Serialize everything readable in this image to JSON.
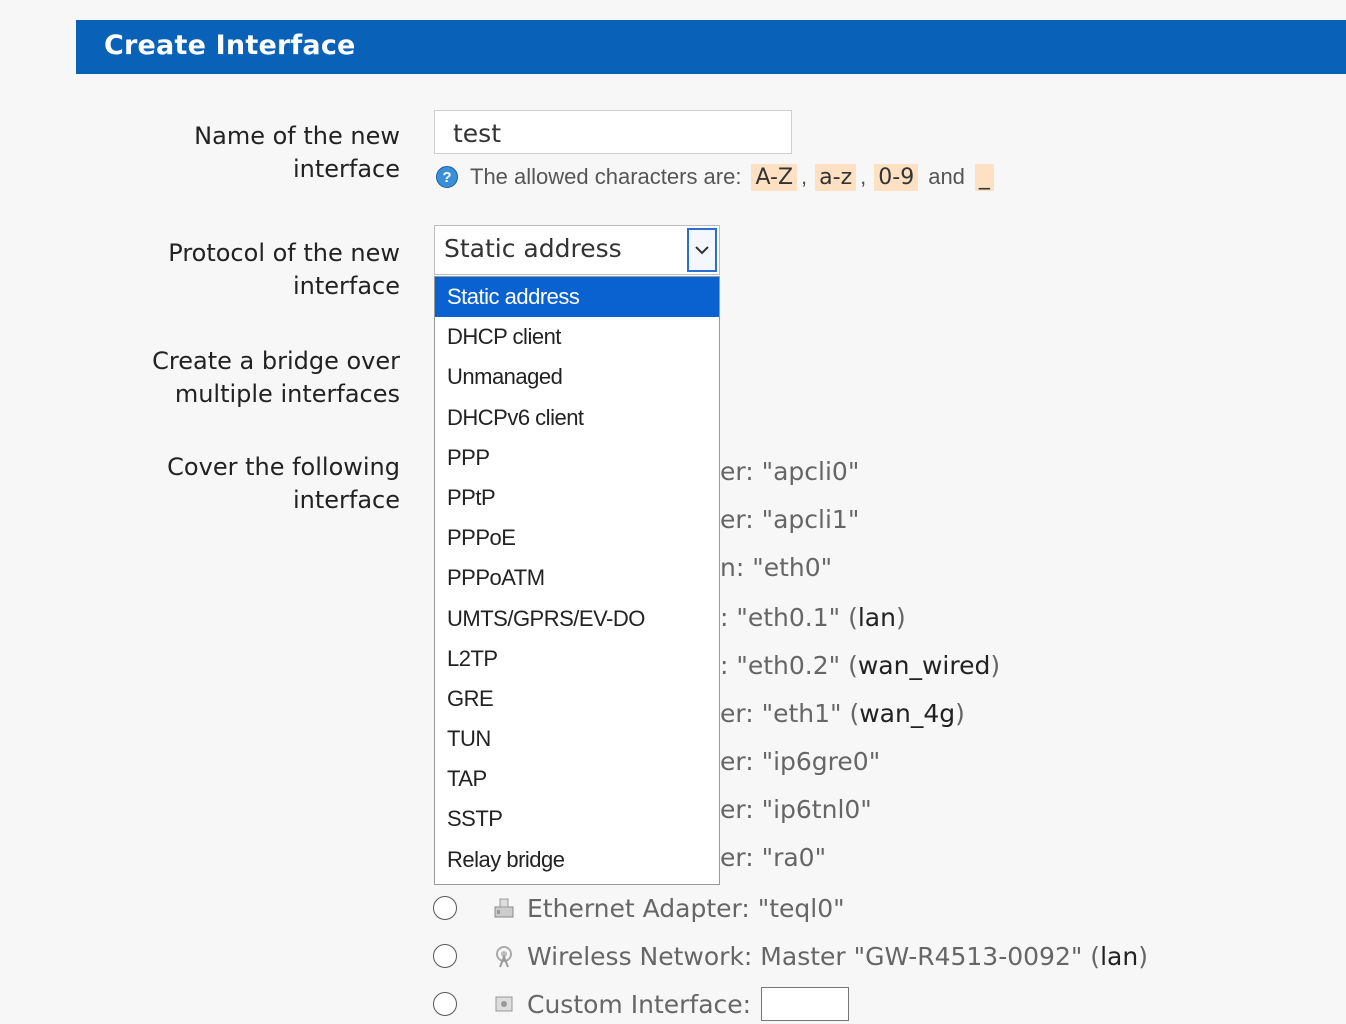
{
  "header": {
    "title": "Create Interface"
  },
  "form": {
    "name_label": "Name of the new interface",
    "name_value": "test",
    "hint": {
      "prefix": "The allowed characters are:",
      "c1": "A-Z",
      "c2": "a-z",
      "c3": "0-9",
      "and": "and",
      "c4": "_"
    },
    "protocol_label": "Protocol of the new interface",
    "protocol_selected": "Static address",
    "protocol_options": [
      "Static address",
      "DHCP client",
      "Unmanaged",
      "DHCPv6 client",
      "PPP",
      "PPtP",
      "PPPoE",
      "PPPoATM",
      "UMTS/GPRS/EV-DO",
      "L2TP",
      "GRE",
      "TUN",
      "TAP",
      "SSTP",
      "Relay bridge"
    ],
    "bridge_label": "Create a bridge over multiple interfaces",
    "cover_label": "Cover the following interface"
  },
  "interfaces_partial": [
    {
      "text": "er: \"apcli0\"",
      "net": ""
    },
    {
      "text": "er: \"apcli1\"",
      "net": ""
    },
    {
      "text": "n: \"eth0\"",
      "net": ""
    },
    {
      "text": ": \"eth0.1\" (",
      "net": "lan",
      "close": ")"
    },
    {
      "text": ": \"eth0.2\" (",
      "net": "wan_wired",
      "close": ")"
    },
    {
      "text": "er: \"eth1\" (",
      "net": "wan_4g",
      "close": ")"
    },
    {
      "text": "er: \"ip6gre0\"",
      "net": ""
    },
    {
      "text": "er: \"ip6tnl0\"",
      "net": ""
    },
    {
      "text": "er: \"ra0\"",
      "net": ""
    }
  ],
  "interfaces_full": [
    {
      "text": "Ethernet Adapter: \"teql0\"",
      "icon": "ethernet-adapter-icon"
    },
    {
      "text": "Wireless Network: Master \"GW-R4513-0092\" (",
      "net": "lan",
      "close": ")",
      "icon": "wireless-icon"
    },
    {
      "text": "Custom Interface:",
      "icon": "custom-interface-icon"
    }
  ]
}
